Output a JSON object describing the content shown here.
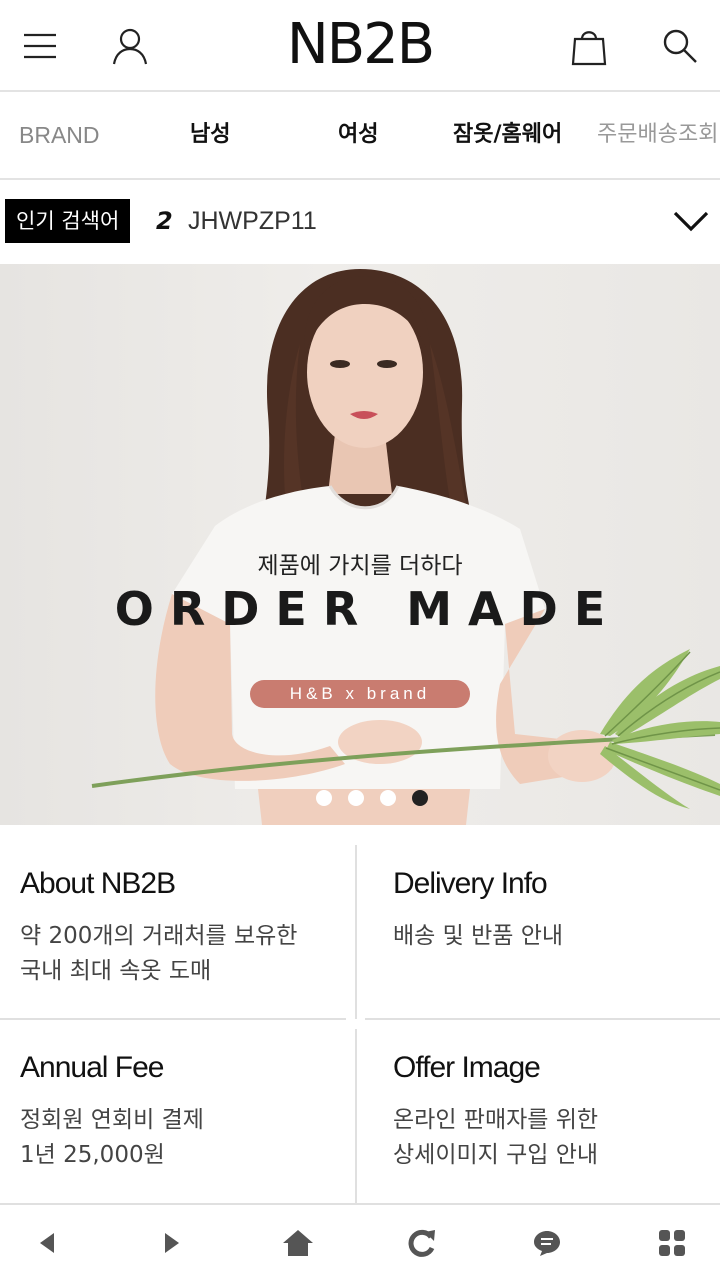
{
  "header": {
    "logo": "NB2B",
    "icons": [
      "menu-icon",
      "user-icon",
      "shopping-bag-icon",
      "search-icon"
    ]
  },
  "category_nav": {
    "items": [
      {
        "label": "BRAND"
      },
      {
        "label": "남성"
      },
      {
        "label": "여성"
      },
      {
        "label": "잠옷/홈웨어"
      },
      {
        "label": "주문배송조회"
      }
    ]
  },
  "popular_search": {
    "badge": "인기 검색어",
    "rank": "2",
    "term": "JHWPZP11"
  },
  "banner": {
    "subtitle": "제품에 가치를 더하다",
    "title": "ORDER MADE",
    "pill": "H&B x brand",
    "slides_total": 4,
    "active_slide": 4
  },
  "info_cards": [
    {
      "title": "About NB2B",
      "line1": "약 200개의 거래처를 보유한",
      "line2": "국내 최대 속옷 도매"
    },
    {
      "title": "Delivery Info",
      "line1": "배송 및 반품 안내",
      "line2": ""
    },
    {
      "title": "Annual Fee",
      "line1": "정회원 연회비 결제",
      "line2": "1년 25,000원"
    },
    {
      "title": "Offer Image",
      "line1": "온라인 판매자를 위한",
      "line2": "상세이미지 구입 안내"
    }
  ],
  "bottom_bar": {
    "icons": [
      "back-icon",
      "forward-icon",
      "home-icon",
      "refresh-icon",
      "chat-icon",
      "apps-icon"
    ]
  },
  "colors": {
    "accent_pill": "#c97c70",
    "badge_bg": "#000000",
    "divider": "#e0e0e0"
  }
}
